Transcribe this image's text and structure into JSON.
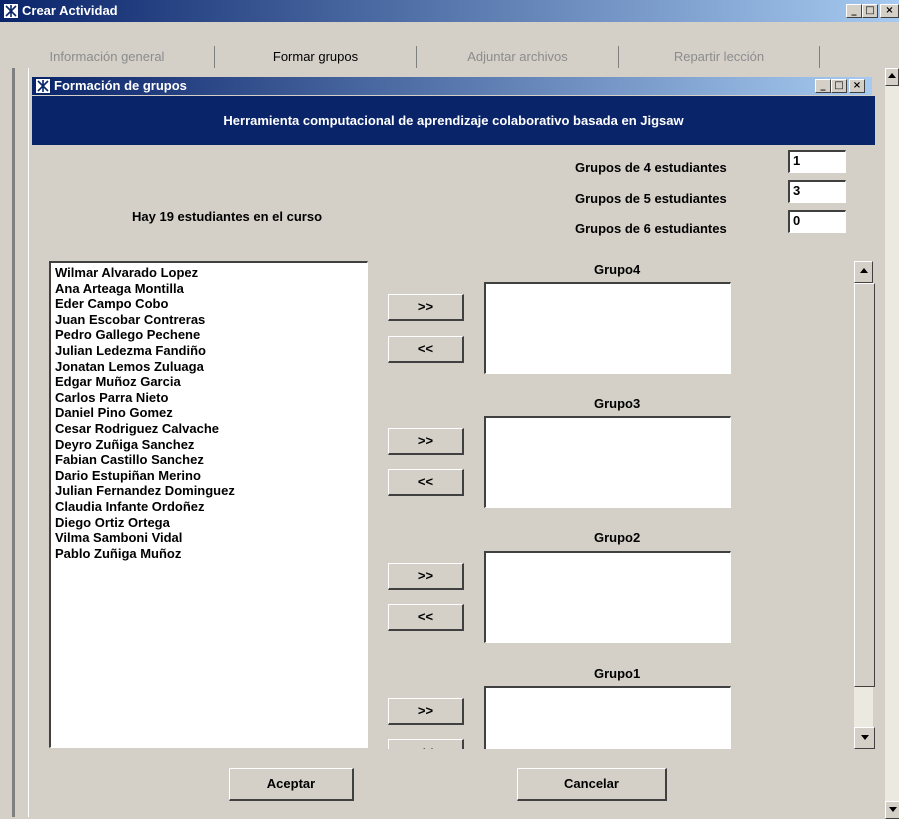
{
  "window": {
    "title": "Crear Actividad"
  },
  "tabs": [
    {
      "label": "Información general",
      "enabled": false
    },
    {
      "label": "Formar grupos",
      "enabled": true
    },
    {
      "label": "Adjuntar archivos",
      "enabled": false
    },
    {
      "label": "Repartir lección",
      "enabled": false
    }
  ],
  "dialog": {
    "title": "Formación de grupos",
    "header": "Herramienta computacional de aprendizaje colaborativo basada en Jigsaw"
  },
  "summary": "Hay 19 estudiantes en el curso",
  "group_sizes": [
    {
      "label": "Grupos de 4 estudiantes",
      "value": "1"
    },
    {
      "label": "Grupos de 5 estudiantes",
      "value": "3"
    },
    {
      "label": "Grupos de 6 estudiantes",
      "value": "0"
    }
  ],
  "students": [
    "Wilmar Alvarado  Lopez",
    "Ana Arteaga  Montilla",
    "Eder Campo  Cobo",
    "Juan Escobar  Contreras",
    "Pedro Gallego  Pechene",
    "Julian Ledezma  Fandiño",
    "Jonatan Lemos  Zuluaga",
    "Edgar Muñoz  Garcia",
    "Carlos Parra  Nieto",
    "Daniel Pino  Gomez",
    "Cesar Rodriguez  Calvache",
    "Deyro Zuñiga  Sanchez",
    "Fabian Castillo  Sanchez",
    "Dario Estupiñan  Merino",
    "Julian Fernandez  Dominguez",
    "Claudia  Infante  Ordoñez",
    "Diego Ortiz  Ortega",
    "Vilma Samboni  Vidal",
    "Pablo  Zuñiga  Muñoz"
  ],
  "groups": [
    {
      "label": "Grupo4"
    },
    {
      "label": "Grupo3"
    },
    {
      "label": "Grupo2"
    },
    {
      "label": "Grupo1"
    }
  ],
  "buttons": {
    "add": ">>",
    "remove": "<<",
    "accept": "Aceptar",
    "cancel": "Cancelar"
  },
  "window_controls": {
    "minimize": "_",
    "maximize": "□",
    "close": "×"
  }
}
